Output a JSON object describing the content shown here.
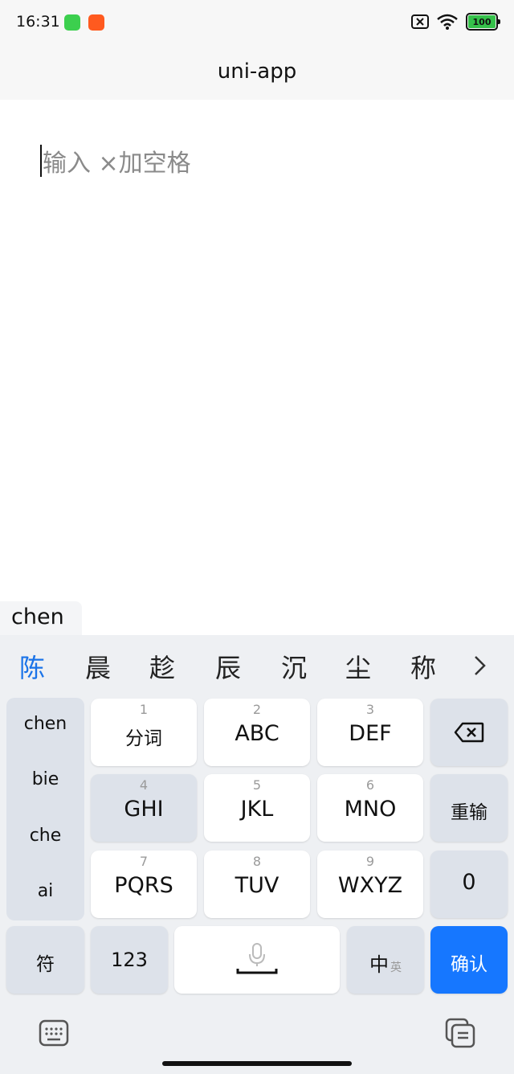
{
  "status_bar": {
    "time": "16:31",
    "battery": "100",
    "icons": [
      "android-app-icon",
      "recorder-app-icon",
      "no-sim-icon",
      "wifi-icon",
      "battery-icon"
    ],
    "colors": {
      "app_green": "#3ccf4e",
      "app_orange": "#ff5a1f",
      "battery_green": "#35c14a"
    }
  },
  "nav": {
    "title": "uni-app"
  },
  "input": {
    "placeholder": "输入 ×加空格"
  },
  "ime": {
    "composing": "chen",
    "candidates": [
      "陈",
      "晨",
      "趁",
      "辰",
      "沉",
      "尘",
      "称"
    ],
    "pinyin_options": [
      "chen",
      "bie",
      "che",
      "ai"
    ],
    "keys": {
      "k1": {
        "num": "1",
        "label": "分词"
      },
      "k2": {
        "num": "2",
        "label": "ABC"
      },
      "k3": {
        "num": "3",
        "label": "DEF"
      },
      "k4": {
        "num": "4",
        "label": "GHI"
      },
      "k5": {
        "num": "5",
        "label": "JKL"
      },
      "k6": {
        "num": "6",
        "label": "MNO"
      },
      "k7": {
        "num": "7",
        "label": "PQRS"
      },
      "k8": {
        "num": "8",
        "label": "TUV"
      },
      "k9": {
        "num": "9",
        "label": "WXYZ"
      }
    },
    "reinput": "重输",
    "zero": "0",
    "symbols": "符",
    "numbers": "123",
    "lang_main": "中",
    "lang_sub": "英",
    "confirm": "确认",
    "accent_color": "#1677ff"
  }
}
